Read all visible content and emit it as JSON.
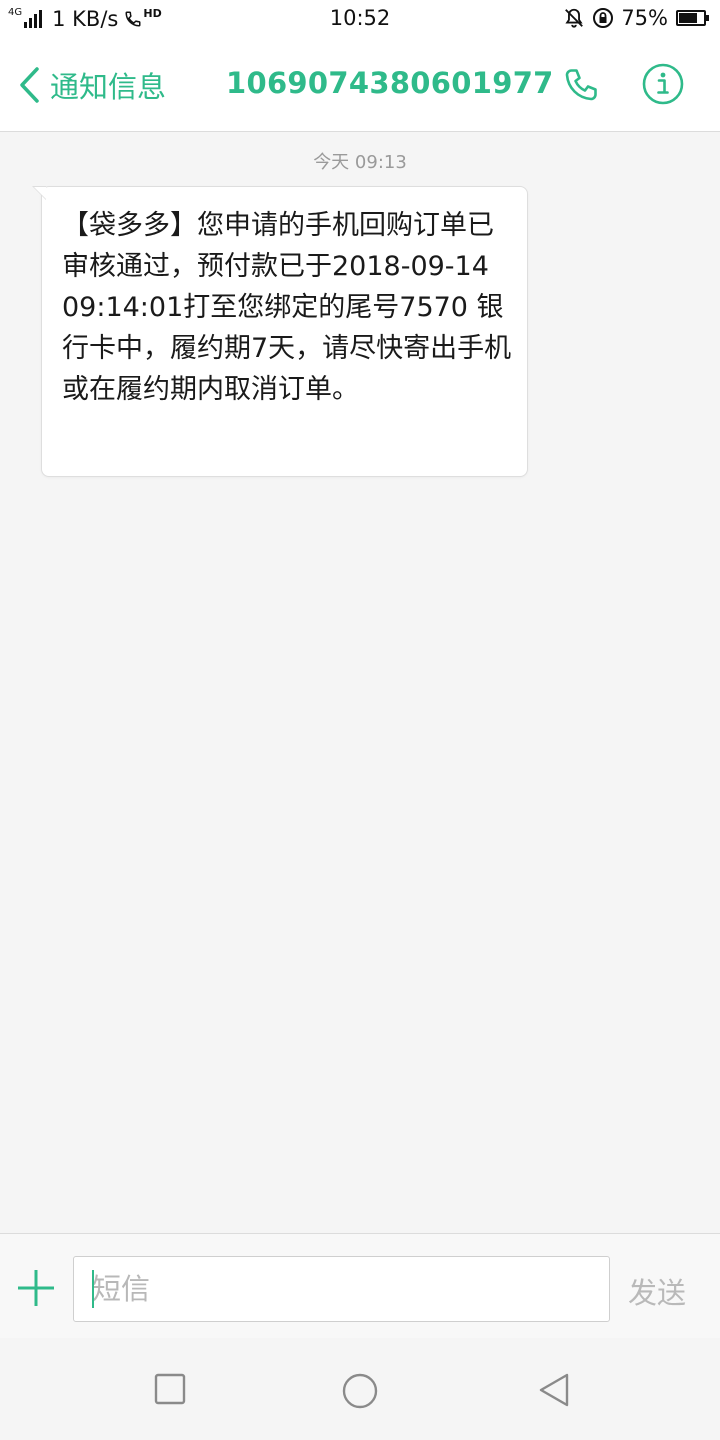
{
  "status_bar": {
    "network": "4G",
    "speed": "1 KB/s",
    "hd": "HD",
    "time": "10:52",
    "battery_pct": "75%",
    "battery_level": 0.75
  },
  "header": {
    "back_label": "通知信息",
    "contact_number": "1069074380601977"
  },
  "conversation": {
    "timestamp": "今天 09:13",
    "messages": [
      {
        "text": "【袋多多】您申请的手机回购订单已审核通过，预付款已于2018-09-14 09:14:01打至您绑定的尾号7570 银行卡中，履约期7天，请尽快寄出手机或在履约期内取消订单。"
      }
    ]
  },
  "composer": {
    "placeholder": "短信",
    "value": "",
    "send_label": "发送"
  },
  "colors": {
    "accent": "#2fba8a",
    "background": "#f5f5f5"
  },
  "icons": {
    "back": "chevron-left-icon",
    "call": "phone-icon",
    "info": "info-icon",
    "attach": "plus-icon",
    "nav_recent": "square-icon",
    "nav_home": "circle-icon",
    "nav_back": "triangle-back-icon"
  }
}
